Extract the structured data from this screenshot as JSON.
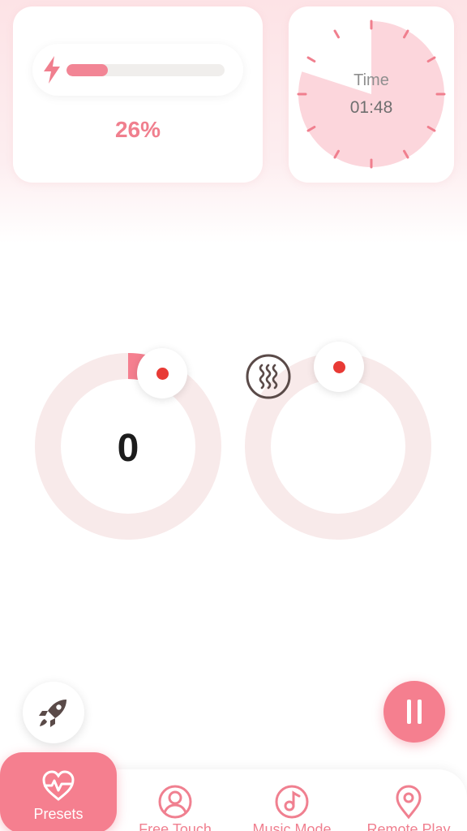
{
  "battery": {
    "percent_text": "26%",
    "level": 0.26,
    "icon": "lightning-bolt-icon"
  },
  "timer": {
    "label": "Time",
    "value": "01:48",
    "progress": 0.8
  },
  "dials": {
    "intensity": {
      "value": "0",
      "progress": 0.03
    },
    "mode": {
      "icon": "vibration-wave-icon"
    }
  },
  "buttons": {
    "boost_icon": "rocket-icon",
    "pause_icon": "pause-icon"
  },
  "nav": {
    "items": [
      {
        "label": "Presets",
        "icon": "heart-pulse-icon",
        "active": true
      },
      {
        "label": "Free Touch",
        "icon": "user-icon",
        "active": false
      },
      {
        "label": "Music Mode",
        "icon": "music-note-icon",
        "active": false
      },
      {
        "label": "Remote Play",
        "icon": "location-pin-icon",
        "active": false
      }
    ]
  },
  "colors": {
    "accent": "#f57f8f",
    "track": "#f8eaea",
    "timer_fill": "#fcd6dc",
    "tick": "#f07f8e",
    "dot": "#e83a35",
    "icon_dark": "#5a4a48"
  }
}
